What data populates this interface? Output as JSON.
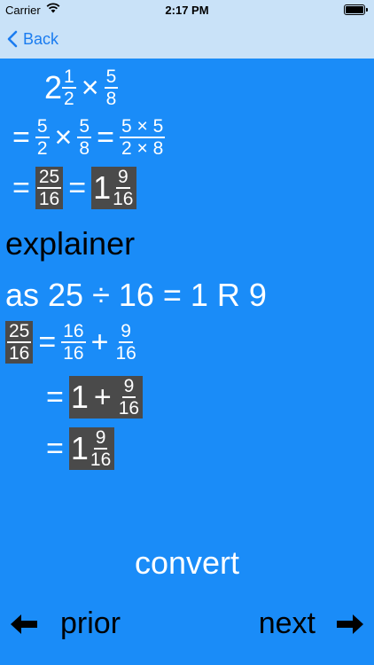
{
  "status": {
    "carrier": "Carrier",
    "time": "2:17 PM"
  },
  "nav": {
    "back_label": "Back"
  },
  "step1": {
    "whole": "2",
    "a_num": "1",
    "a_den": "2",
    "times": "×",
    "b_num": "5",
    "b_den": "8"
  },
  "step2": {
    "eq": "=",
    "a_num": "5",
    "a_den": "2",
    "times": "×",
    "b_num": "5",
    "b_den": "8",
    "eq2": "=",
    "c_num": "5 × 5",
    "c_den": "2 × 8"
  },
  "step3": {
    "eq": "=",
    "a_num": "25",
    "a_den": "16",
    "eq2": "=",
    "whole": "1",
    "b_num": "9",
    "b_den": "16"
  },
  "explainer_label": "explainer",
  "division_text": "as 25 ÷ 16 = 1 R 9",
  "exp1": {
    "a_num": "25",
    "a_den": "16",
    "eq": "=",
    "b_num": "16",
    "b_den": "16",
    "plus": "+",
    "c_num": "9",
    "c_den": "16"
  },
  "exp2": {
    "eq": "=",
    "whole": "1",
    "plus": "+",
    "num": "9",
    "den": "16"
  },
  "exp3": {
    "eq": "=",
    "whole": "1",
    "num": "9",
    "den": "16"
  },
  "convert_label": "convert",
  "bottom": {
    "prior_label": "prior",
    "next_label": "next"
  },
  "colors": {
    "background": "#1a8cf8",
    "bar": "#c9e2f8",
    "highlight": "#4a4a4a",
    "link": "#1a7cf0"
  }
}
